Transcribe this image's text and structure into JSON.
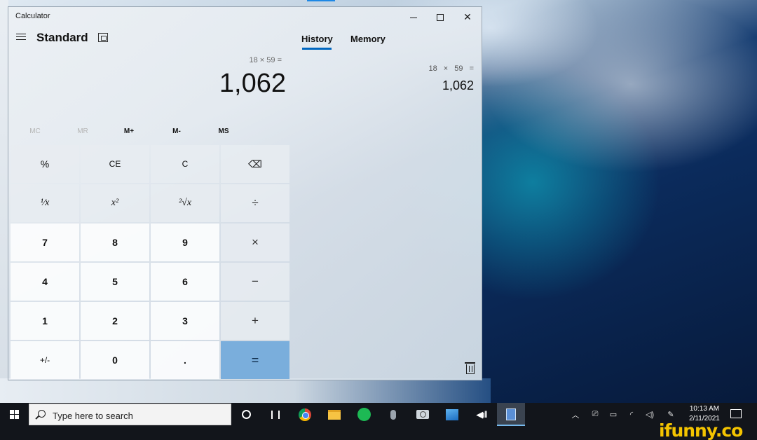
{
  "window": {
    "title": "Calculator",
    "mode": "Standard",
    "tabs": [
      "History",
      "Memory"
    ],
    "active_tab": "History"
  },
  "display": {
    "expression": "18 × 59 =",
    "value": "1,062"
  },
  "history": {
    "expression": "18 × 59 =",
    "result": "1,062"
  },
  "memory_buttons": [
    {
      "label": "MC",
      "enabled": false
    },
    {
      "label": "MR",
      "enabled": false
    },
    {
      "label": "M+",
      "enabled": true
    },
    {
      "label": "M-",
      "enabled": true
    },
    {
      "label": "MS",
      "enabled": true
    }
  ],
  "keys": [
    [
      "%",
      "CE",
      "C",
      "⌫"
    ],
    [
      "¹⁄x",
      "x²",
      "²√x",
      "÷"
    ],
    [
      "7",
      "8",
      "9",
      "×"
    ],
    [
      "4",
      "5",
      "6",
      "−"
    ],
    [
      "1",
      "2",
      "3",
      "+"
    ],
    [
      "+/-",
      "0",
      ".",
      "="
    ]
  ],
  "taskbar": {
    "search_placeholder": "Type here to search",
    "time": "10:13 AM",
    "date": "2/11/2021"
  },
  "watermark": "ifunny.co",
  "colors": {
    "accent": "#0067c0",
    "equals_key": "#7aaedc",
    "taskbar": "#12151b",
    "watermark": "#f4c400"
  }
}
